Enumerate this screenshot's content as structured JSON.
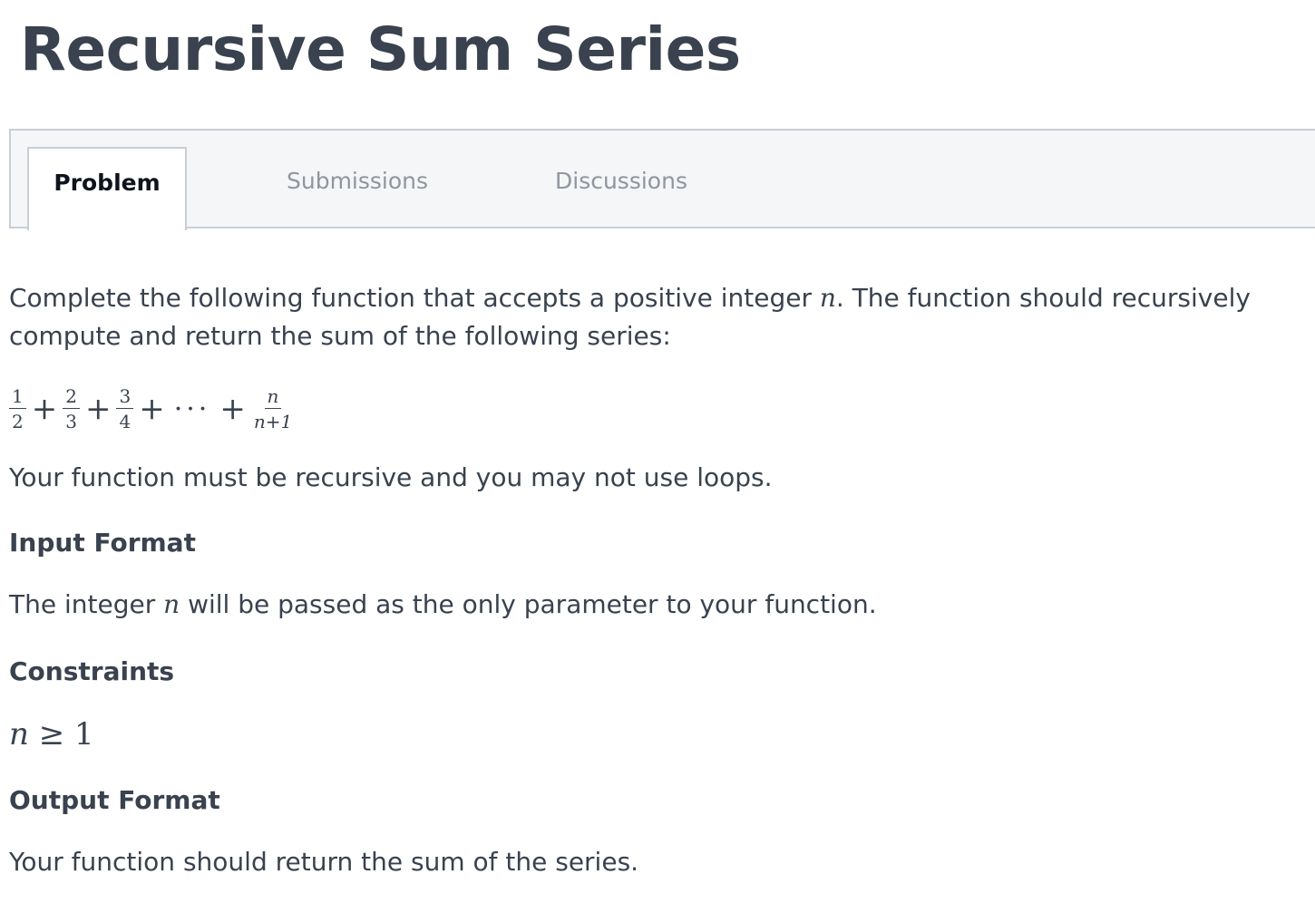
{
  "title": "Recursive Sum Series",
  "tabs": [
    {
      "label": "Problem",
      "active": true
    },
    {
      "label": "Submissions",
      "active": false
    },
    {
      "label": "Discussions",
      "active": false
    }
  ],
  "description": {
    "part1": "Complete the following function that accepts a positive integer ",
    "var": "n",
    "part2": ". The function should recursively compute and return the sum of the following series:"
  },
  "series": {
    "terms": [
      {
        "num": "1",
        "den": "2"
      },
      {
        "num": "2",
        "den": "3"
      },
      {
        "num": "3",
        "den": "4"
      }
    ],
    "plus": "+",
    "ellipsis": "···",
    "last": {
      "num": "n",
      "den": "n+1"
    }
  },
  "note": "Your function must be recursive and you may not use loops.",
  "input_format": {
    "heading": "Input Format",
    "part1": "The integer ",
    "var": "n",
    "part2": " will be passed as the only parameter to your function."
  },
  "constraints": {
    "heading": "Constraints",
    "var": "n",
    "expr": " ≥ 1"
  },
  "output_format": {
    "heading": "Output Format",
    "text": "Your function should return the sum of the series."
  },
  "colors": {
    "text": "#39424e",
    "active_tab_text": "#0e141e",
    "inactive_tab_text": "#8f969f",
    "tab_bar_bg": "#f4f6f8",
    "border": "#c9ced6"
  }
}
